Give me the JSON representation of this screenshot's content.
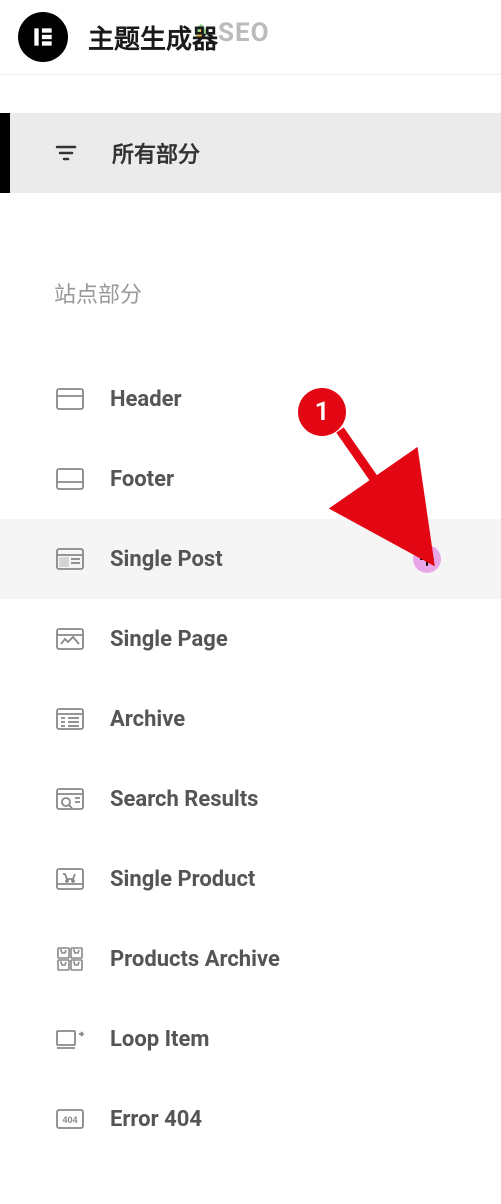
{
  "header": {
    "title": "主题生成器",
    "watermark_text": "SEO"
  },
  "menu": {
    "all_parts_label": "所有部分"
  },
  "section_label": "站点部分",
  "items": [
    {
      "label": "Header"
    },
    {
      "label": "Footer"
    },
    {
      "label": "Single Post"
    },
    {
      "label": "Single Page"
    },
    {
      "label": "Archive"
    },
    {
      "label": "Search Results"
    },
    {
      "label": "Single Product"
    },
    {
      "label": "Products Archive"
    },
    {
      "label": "Loop Item"
    },
    {
      "label": "Error 404"
    }
  ],
  "hovered_index": 2,
  "annotation": {
    "badge_text": "1"
  }
}
